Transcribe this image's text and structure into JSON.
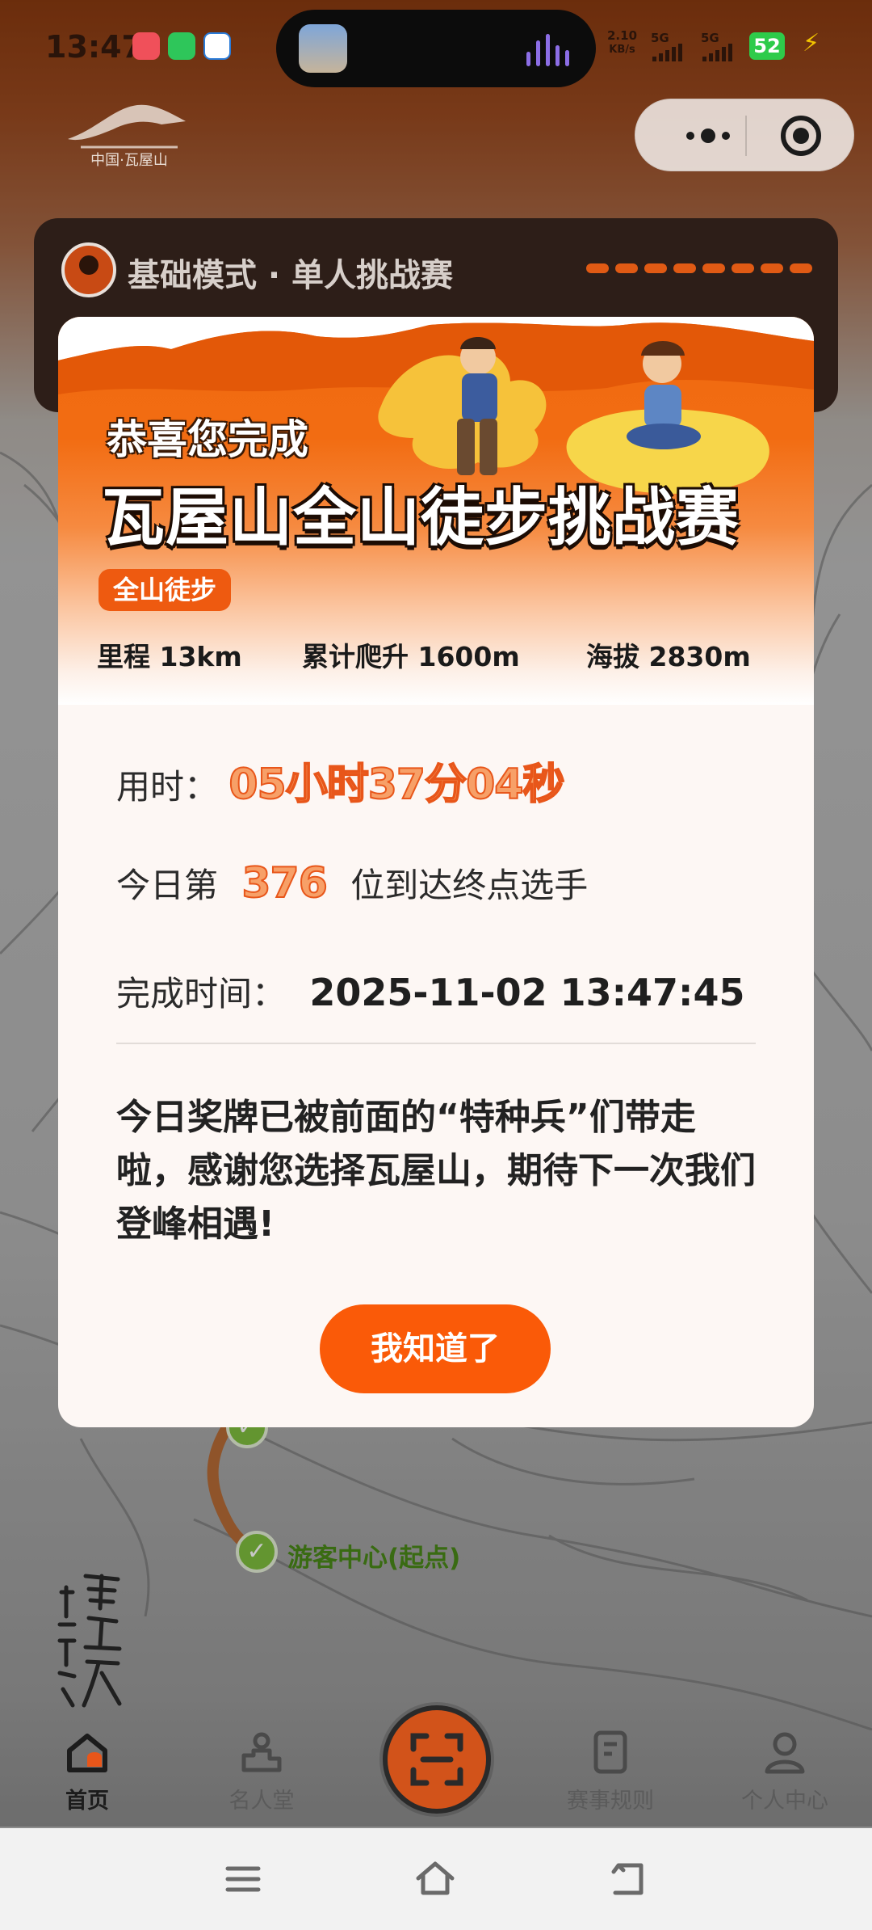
{
  "status_bar": {
    "time": "13:47",
    "net_speed": "2.10",
    "net_unit": "KB/s",
    "sim1": "5G",
    "sim2": "5G",
    "battery": "52"
  },
  "header": {
    "logo_alt": "中国·瓦屋山"
  },
  "mode_bar": {
    "title": "基础模式 · 单人挑战赛"
  },
  "modal": {
    "greeting": "恭喜您完成",
    "event_name": "瓦屋山全山徒步挑战赛",
    "tag": "全山徒步",
    "stats": [
      {
        "label": "里程",
        "value": "13km"
      },
      {
        "label": "累计爬升",
        "value": "1600m"
      },
      {
        "label": "海拔",
        "value": "2830m"
      }
    ],
    "duration_label": "用时：",
    "duration_value": "05小时37分04秒",
    "rank_prefix": "今日第",
    "rank_value": "376",
    "rank_suffix": "位到达终点选手",
    "finish_label": "完成时间：",
    "finish_value": "2025-11-02 13:47:45",
    "message": "今日奖牌已被前面的“特种兵”们带走啦，感谢您选择瓦屋山，期待下一次我们登峰相遇!",
    "confirm_button": "我知道了"
  },
  "map": {
    "checkpoint_start": "游客中心(起点)"
  },
  "tabbar": {
    "items": [
      {
        "label": "首页",
        "icon": "home-icon",
        "active": true
      },
      {
        "label": "名人堂",
        "icon": "podium-icon",
        "active": false
      },
      {
        "label": "",
        "icon": "scan-icon",
        "active": false
      },
      {
        "label": "赛事规则",
        "icon": "document-icon",
        "active": false
      },
      {
        "label": "个人中心",
        "icon": "user-icon",
        "active": false
      }
    ]
  },
  "colors": {
    "accent": "#fa5a08",
    "banner_orange": "#f06a10",
    "checkpoint_green": "#7fbf3e"
  }
}
